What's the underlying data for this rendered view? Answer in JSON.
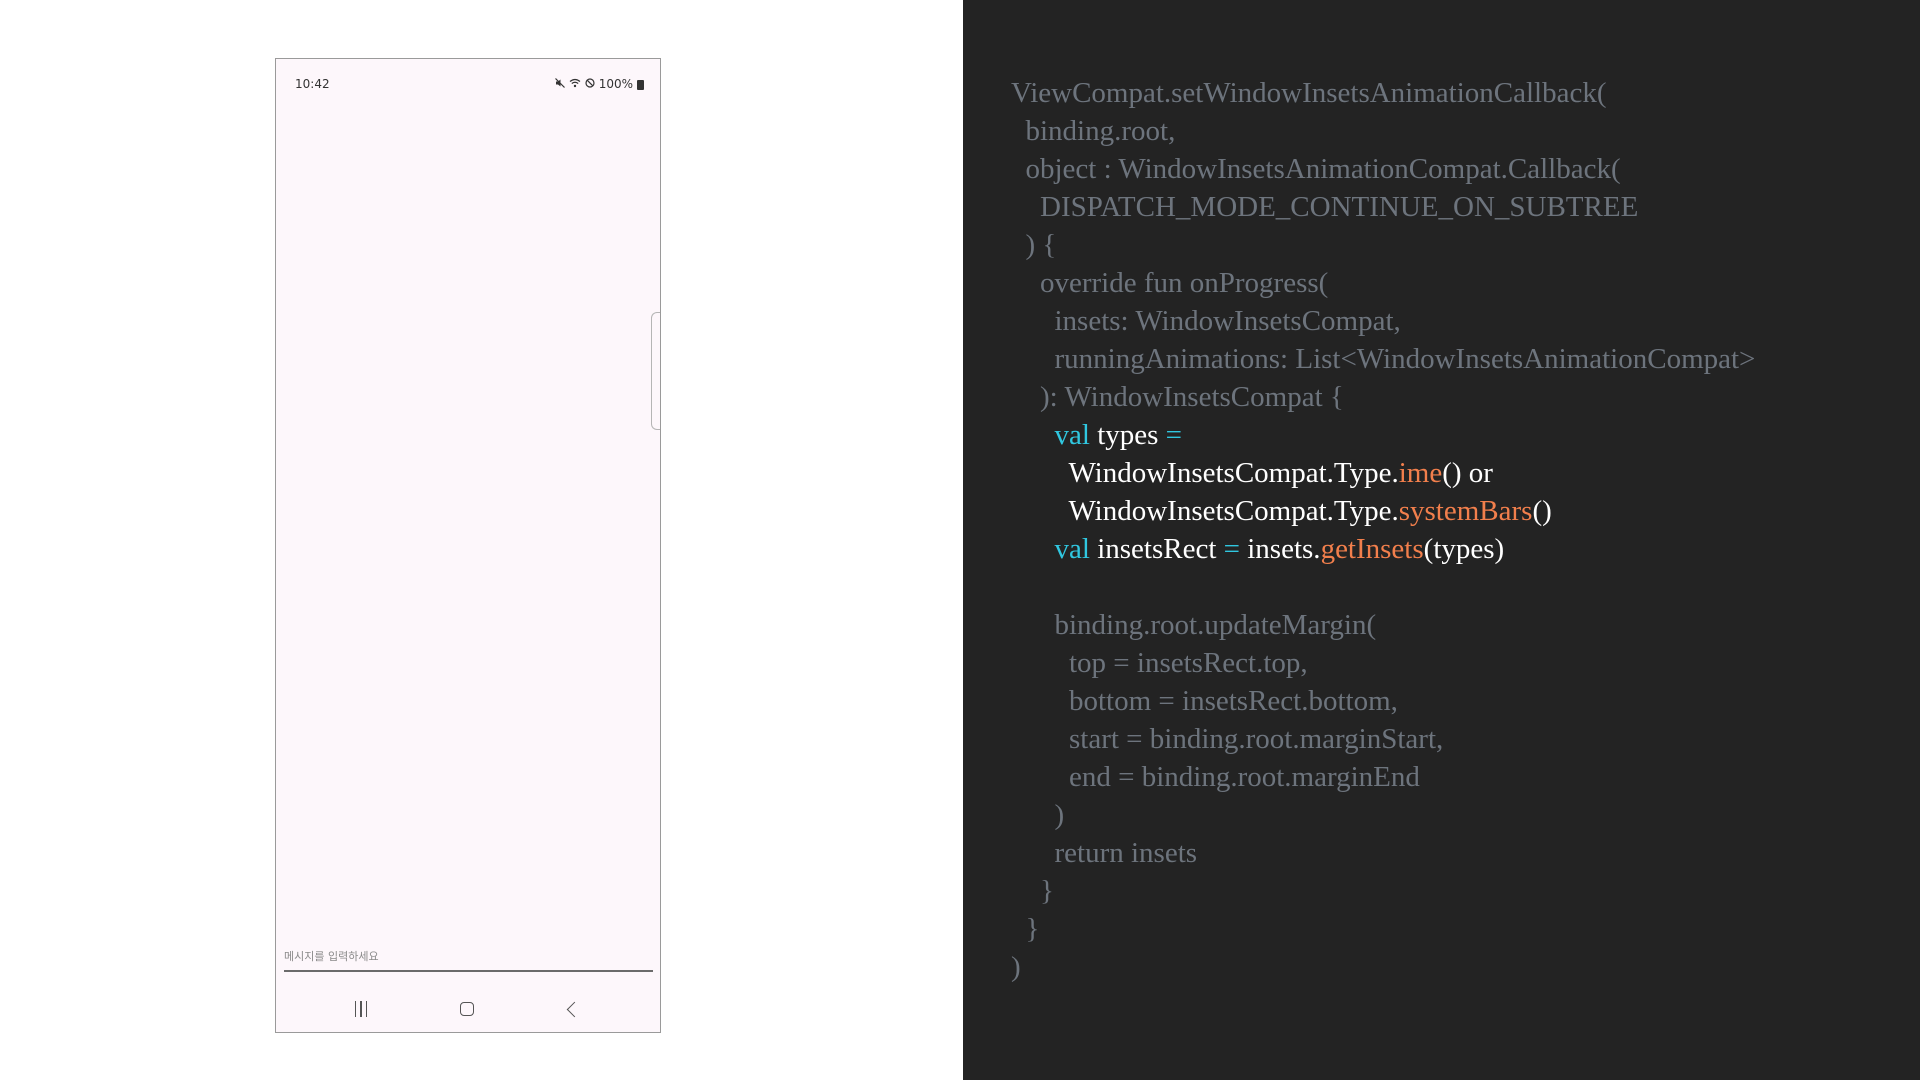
{
  "phone": {
    "status_bar": {
      "time": "10:42",
      "icons": [
        "mute-icon",
        "wifi-icon",
        "do-not-disturb-icon"
      ],
      "battery_text": "100%"
    },
    "message_input": {
      "placeholder": "메시지를 입력하세요",
      "value": ""
    },
    "nav": {
      "recents_icon": "recents-icon",
      "home_icon": "home-icon",
      "back_icon": "back-icon"
    }
  },
  "code_panel": {
    "colors": {
      "background": "#232323",
      "dim": "#6d747d",
      "bright": "#ffffff",
      "keyword": "#30c7e0",
      "function": "#f27f4c"
    },
    "lines": [
      [
        {
          "t": "ViewCompat.setWindowInsetsAnimationCallback(",
          "c": "dim"
        }
      ],
      [
        {
          "t": "  binding.root,",
          "c": "dim"
        }
      ],
      [
        {
          "t": "  object : WindowInsetsAnimationCompat.Callback(",
          "c": "dim"
        }
      ],
      [
        {
          "t": "    DISPATCH_MODE_CONTINUE_ON_SUBTREE",
          "c": "dim"
        }
      ],
      [
        {
          "t": "  ) {",
          "c": "dim"
        }
      ],
      [
        {
          "t": "    override fun onProgress(",
          "c": "dim"
        }
      ],
      [
        {
          "t": "      insets: WindowInsetsCompat,",
          "c": "dim"
        }
      ],
      [
        {
          "t": "      runningAnimations: List<WindowInsetsAnimationCompat>",
          "c": "dim"
        }
      ],
      [
        {
          "t": "    ): WindowInsetsCompat {",
          "c": "dim"
        }
      ],
      [
        {
          "t": "      ",
          "c": "dim"
        },
        {
          "t": "val",
          "c": "kw"
        },
        {
          "t": " types ",
          "c": "bright"
        },
        {
          "t": "=",
          "c": "kw"
        }
      ],
      [
        {
          "t": "        WindowInsetsCompat.Type.",
          "c": "bright"
        },
        {
          "t": "ime",
          "c": "fn"
        },
        {
          "t": "() or",
          "c": "bright"
        }
      ],
      [
        {
          "t": "        WindowInsetsCompat.Type.",
          "c": "bright"
        },
        {
          "t": "systemBars",
          "c": "fn"
        },
        {
          "t": "()",
          "c": "bright"
        }
      ],
      [
        {
          "t": "      ",
          "c": "dim"
        },
        {
          "t": "val",
          "c": "kw"
        },
        {
          "t": " insetsRect ",
          "c": "bright"
        },
        {
          "t": "=",
          "c": "kw"
        },
        {
          "t": " insets.",
          "c": "bright"
        },
        {
          "t": "getInsets",
          "c": "fn"
        },
        {
          "t": "(types)",
          "c": "bright"
        }
      ],
      [
        {
          "t": "",
          "c": "dim"
        }
      ],
      [
        {
          "t": "      binding.root.updateMargin(",
          "c": "dim"
        }
      ],
      [
        {
          "t": "        top = insetsRect.top,",
          "c": "dim"
        }
      ],
      [
        {
          "t": "        bottom = insetsRect.bottom,",
          "c": "dim"
        }
      ],
      [
        {
          "t": "        start = binding.root.marginStart,",
          "c": "dim"
        }
      ],
      [
        {
          "t": "        end = binding.root.marginEnd",
          "c": "dim"
        }
      ],
      [
        {
          "t": "      )",
          "c": "dim"
        }
      ],
      [
        {
          "t": "      return insets",
          "c": "dim"
        }
      ],
      [
        {
          "t": "    }",
          "c": "dim"
        }
      ],
      [
        {
          "t": "  }",
          "c": "dim"
        }
      ],
      [
        {
          "t": ")",
          "c": "dim"
        }
      ]
    ]
  }
}
